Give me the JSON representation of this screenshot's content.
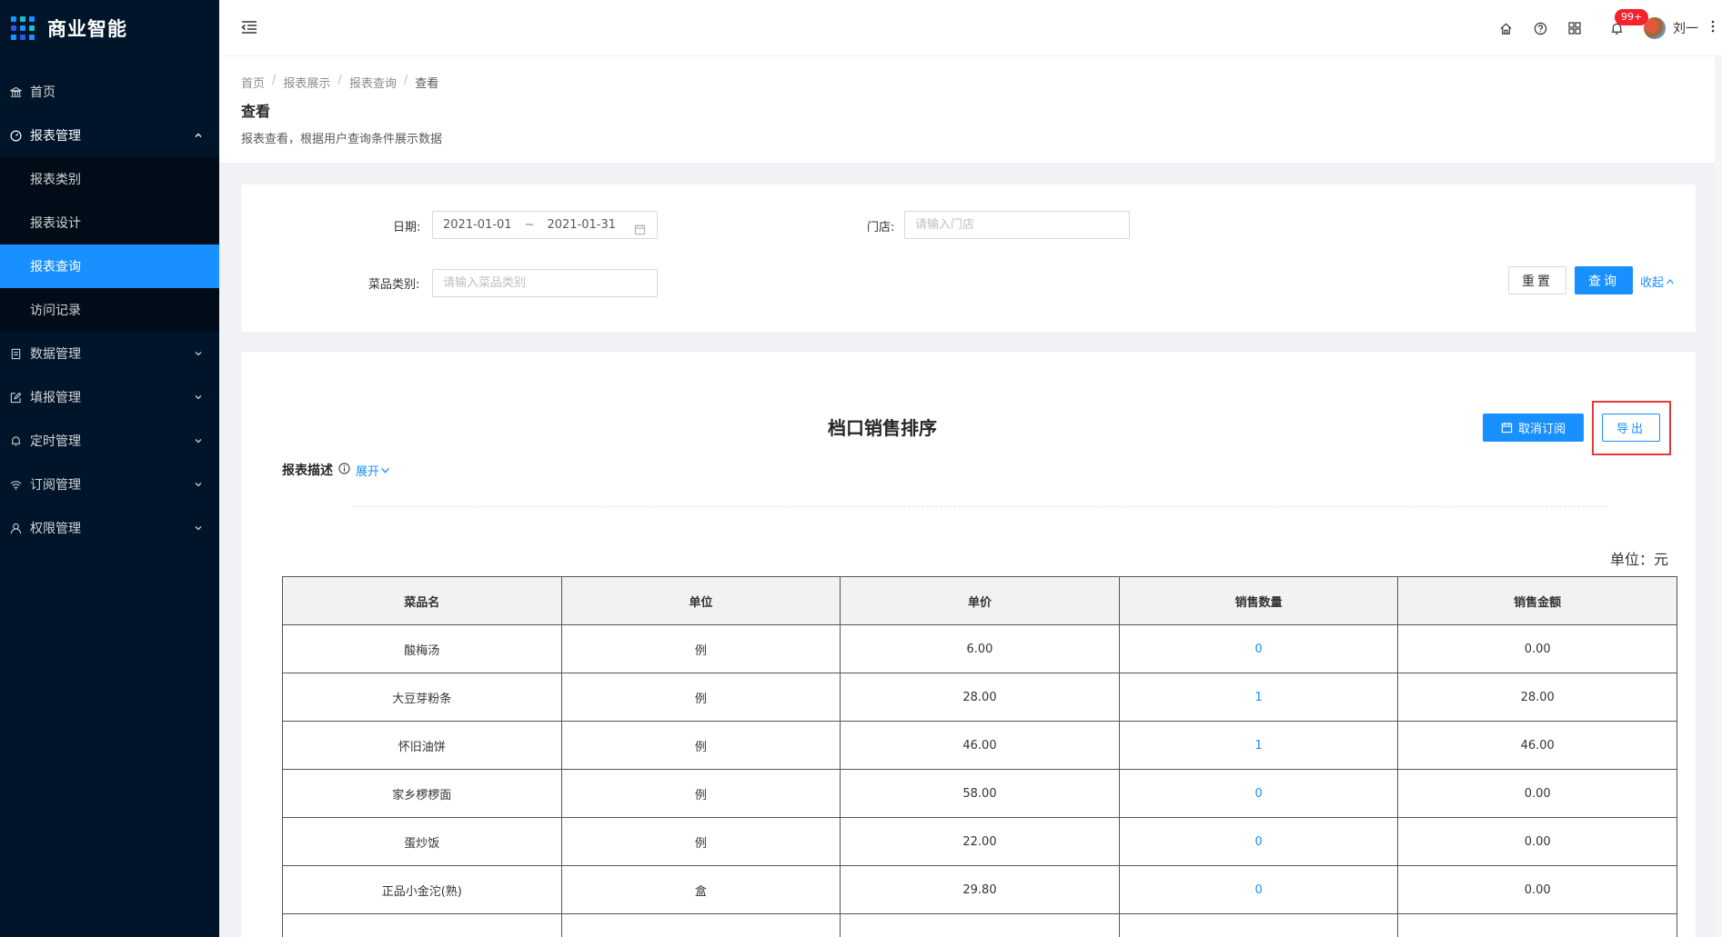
{
  "app": {
    "title": "商业智能"
  },
  "sidebar": {
    "items": [
      {
        "label": "首页",
        "icon": "bank-icon"
      },
      {
        "label": "报表管理",
        "icon": "dashboard-icon",
        "expanded": true,
        "children": [
          {
            "label": "报表类别"
          },
          {
            "label": "报表设计"
          },
          {
            "label": "报表查询",
            "active": true
          },
          {
            "label": "访问记录"
          }
        ]
      },
      {
        "label": "数据管理",
        "icon": "database-icon"
      },
      {
        "label": "填报管理",
        "icon": "edit-icon"
      },
      {
        "label": "定时管理",
        "icon": "bell-icon"
      },
      {
        "label": "订阅管理",
        "icon": "wifi-icon"
      },
      {
        "label": "权限管理",
        "icon": "user-icon"
      }
    ]
  },
  "header": {
    "notification_badge": "99+",
    "user_name": "刘一"
  },
  "page": {
    "breadcrumb": [
      "首页",
      "报表展示",
      "报表查询",
      "查看"
    ],
    "breadcrumb_sep": "/",
    "title": "查看",
    "description": "报表查看，根据用户查询条件展示数据"
  },
  "search": {
    "date_label": "日期:",
    "date_start": "2021-01-01",
    "date_sep": "~",
    "date_end": "2021-01-31",
    "store_label": "门店:",
    "store_placeholder": "请输入门店",
    "category_label": "菜品类别:",
    "category_placeholder": "请输入菜品类别",
    "reset_label": "重置",
    "query_label": "查询",
    "collapse_label": "收起"
  },
  "report": {
    "title": "档口销售排序",
    "unsubscribe_label": "取消订阅",
    "export_label": "导出",
    "desc_label": "报表描述",
    "expand_label": "展开",
    "unit": "单位：元",
    "columns": [
      "菜品名",
      "单位",
      "单价",
      "销售数量",
      "销售金额"
    ],
    "rows": [
      [
        "酸梅汤",
        "例",
        "6.00",
        "0",
        "0.00"
      ],
      [
        "大豆芽粉条",
        "例",
        "28.00",
        "1",
        "28.00"
      ],
      [
        "怀旧油饼",
        "例",
        "46.00",
        "1",
        "46.00"
      ],
      [
        "家乡椤椤面",
        "例",
        "58.00",
        "0",
        "0.00"
      ],
      [
        "蛋炒饭",
        "例",
        "22.00",
        "0",
        "0.00"
      ],
      [
        "正品小金沱(熟)",
        "盒",
        "29.80",
        "0",
        "0.00"
      ],
      [
        "",
        "",
        "",
        "",
        ""
      ]
    ]
  },
  "colors": {
    "accent": "#1890ff",
    "sidebar_bg": "#001529",
    "highlight": "#e53935"
  }
}
